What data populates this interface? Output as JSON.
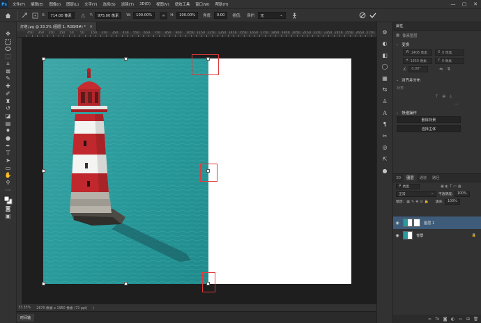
{
  "menubar": {
    "logo": "Ps",
    "items": [
      "文件(F)",
      "编辑(E)",
      "图像(I)",
      "图层(L)",
      "文字(Y)",
      "选择(S)",
      "滤镜(T)",
      "3D(D)",
      "视图(V)",
      "增效工具",
      "窗口(W)",
      "帮助(H)"
    ],
    "window_controls": [
      "—",
      "▢",
      "✕"
    ]
  },
  "options": {
    "x_label": "X:",
    "x_value": "714.00 像素",
    "y_label": "Y:",
    "y_value": "975.00 像素",
    "w_label": "W:",
    "w_value": "100.00%",
    "h_label": "H:",
    "h_value": "100.00%",
    "angle_label": "角度:",
    "angle_value": "0.00",
    "interp_label": "插值:",
    "interp_value": "两次立方",
    "warp_label": "保护:",
    "warp_value": "无"
  },
  "tool_icons": [
    "move-tool",
    "artboard-tool",
    "marquee-tool",
    "lasso-tool",
    "object-select-tool",
    "crop-tool",
    "frame-tool",
    "eyedropper-tool",
    "spot-healing-tool",
    "brush-tool",
    "clone-stamp-tool",
    "history-brush-tool",
    "eraser-tool",
    "gradient-tool",
    "blur-tool",
    "dodge-tool",
    "pen-tool",
    "type-tool",
    "path-select-tool",
    "rectangle-tool",
    "hand-tool",
    "zoom-tool",
    "more-tools",
    "default-colors"
  ],
  "document": {
    "tab_label": "灯塔.jpg @ 33.3% (图层 1, RGB/8#) *",
    "close_glyph": "×"
  },
  "ruler_numbers": [
    "450",
    "400",
    "350",
    "300",
    "250",
    "200",
    "150",
    "100",
    "50",
    "0",
    "50",
    "100",
    "150",
    "200",
    "250",
    "300",
    "350",
    "400",
    "450",
    "500",
    "550",
    "600",
    "650",
    "700",
    "750",
    "800",
    "850",
    "900",
    "950",
    "1000",
    "1050",
    "1100",
    "1150",
    "1200",
    "1250",
    "1300",
    "1350",
    "1400",
    "1450",
    "1500",
    "1550",
    "1600",
    "1650",
    "1700",
    "1750",
    "1800",
    "1850",
    "1900",
    "1950",
    "2000",
    "2050",
    "2100",
    "2150",
    "2200",
    "2250",
    "2300",
    "2350",
    "2400",
    "2450",
    "2500",
    "2550",
    "2600",
    "2650",
    "2700",
    "2750",
    "2800",
    "2850",
    "2900",
    "2950",
    "3000",
    "3050"
  ],
  "status": {
    "zoom": "33.33%",
    "doc_info": "2670 像素 x 1950 像素 (72 ppi)",
    "arrow": "〉"
  },
  "timeline": {
    "tab": "时间轴"
  },
  "properties": {
    "tab": "属性",
    "pixel_layer": "像素图层",
    "transform_title": "变换",
    "w_label": "W",
    "w_value": "1406 像素",
    "x_label": "X",
    "x_value": "0 像素",
    "h_label": "H",
    "h_value": "1950 像素",
    "y_label": "Y",
    "y_value": "0 像素",
    "angle_value": "0.00°",
    "align_title": "对齐并分布",
    "align_sub": "对齐:",
    "quick_title": "快速操作",
    "remove_bg": "删除背景",
    "select_subject": "选择主体"
  },
  "layers": {
    "tabs": [
      "3D",
      "图层",
      "通道",
      "路径"
    ],
    "active_tab": "图层",
    "filter": "类型",
    "blend_mode": "正常",
    "opacity_label": "不透明度:",
    "opacity_value": "100%",
    "lock_label": "锁定:",
    "fill_label": "填充:",
    "fill_value": "100%",
    "items": [
      {
        "name": "图层 1",
        "selected": true
      },
      {
        "name": "背景",
        "selected": false
      }
    ]
  },
  "colors": {
    "accent": "#31a8ff",
    "highlight_box": "#e23a3a",
    "panel_bg": "#323232",
    "selected_layer": "#3e5c7a"
  }
}
